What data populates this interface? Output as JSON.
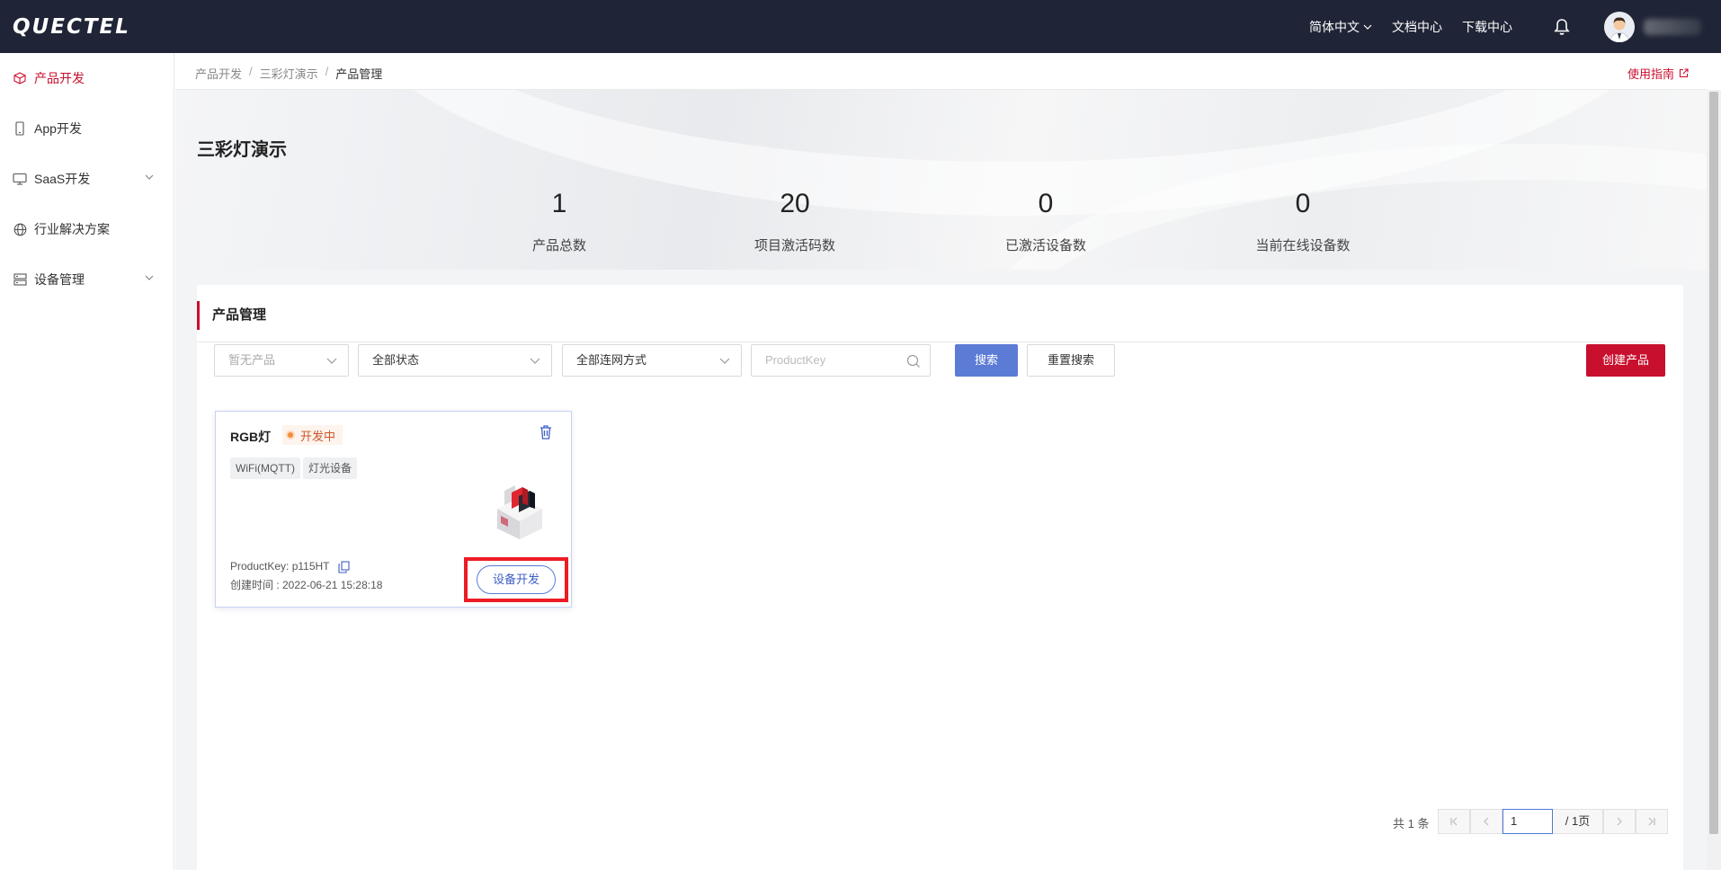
{
  "header": {
    "logo": "QUECTEL",
    "language": "简体中文",
    "docs": "文档中心",
    "downloads": "下载中心"
  },
  "sidebar": {
    "items": [
      {
        "label": "产品开发",
        "icon": "cube-icon",
        "active": true
      },
      {
        "label": "App开发",
        "icon": "phone-icon"
      },
      {
        "label": "SaaS开发",
        "icon": "monitor-icon",
        "expandable": true
      },
      {
        "label": "行业解决方案",
        "icon": "globe-icon"
      },
      {
        "label": "设备管理",
        "icon": "server-icon",
        "expandable": true
      }
    ]
  },
  "breadcrumb": [
    "产品开发",
    "三彩灯演示",
    "产品管理"
  ],
  "guide_link": "使用指南",
  "project": {
    "title": "三彩灯演示",
    "stats": [
      {
        "value": "1",
        "label": "产品总数"
      },
      {
        "value": "20",
        "label": "项目激活码数"
      },
      {
        "value": "0",
        "label": "已激活设备数"
      },
      {
        "value": "0",
        "label": "当前在线设备数"
      }
    ]
  },
  "panel": {
    "title": "产品管理",
    "filters": {
      "product": "暂无产品",
      "status": "全部状态",
      "network": "全部连网方式",
      "productkey_placeholder": "ProductKey"
    },
    "search_btn": "搜索",
    "reset_btn": "重置搜索",
    "create_btn": "创建产品"
  },
  "card": {
    "name": "RGB灯",
    "status": "开发中",
    "tags": [
      "WiFi(MQTT)",
      "灯光设备"
    ],
    "productkey": "ProductKey: p115HT",
    "created": "创建时间 : 2022-06-21 15:28:18",
    "dev_btn": "设备开发"
  },
  "pagination": {
    "total": "共 1 条",
    "current": "1",
    "pages": "/ 1页"
  },
  "colors": {
    "brand": "#c8102e",
    "topbar": "#1f2536",
    "primary": "#5b7bd5"
  }
}
